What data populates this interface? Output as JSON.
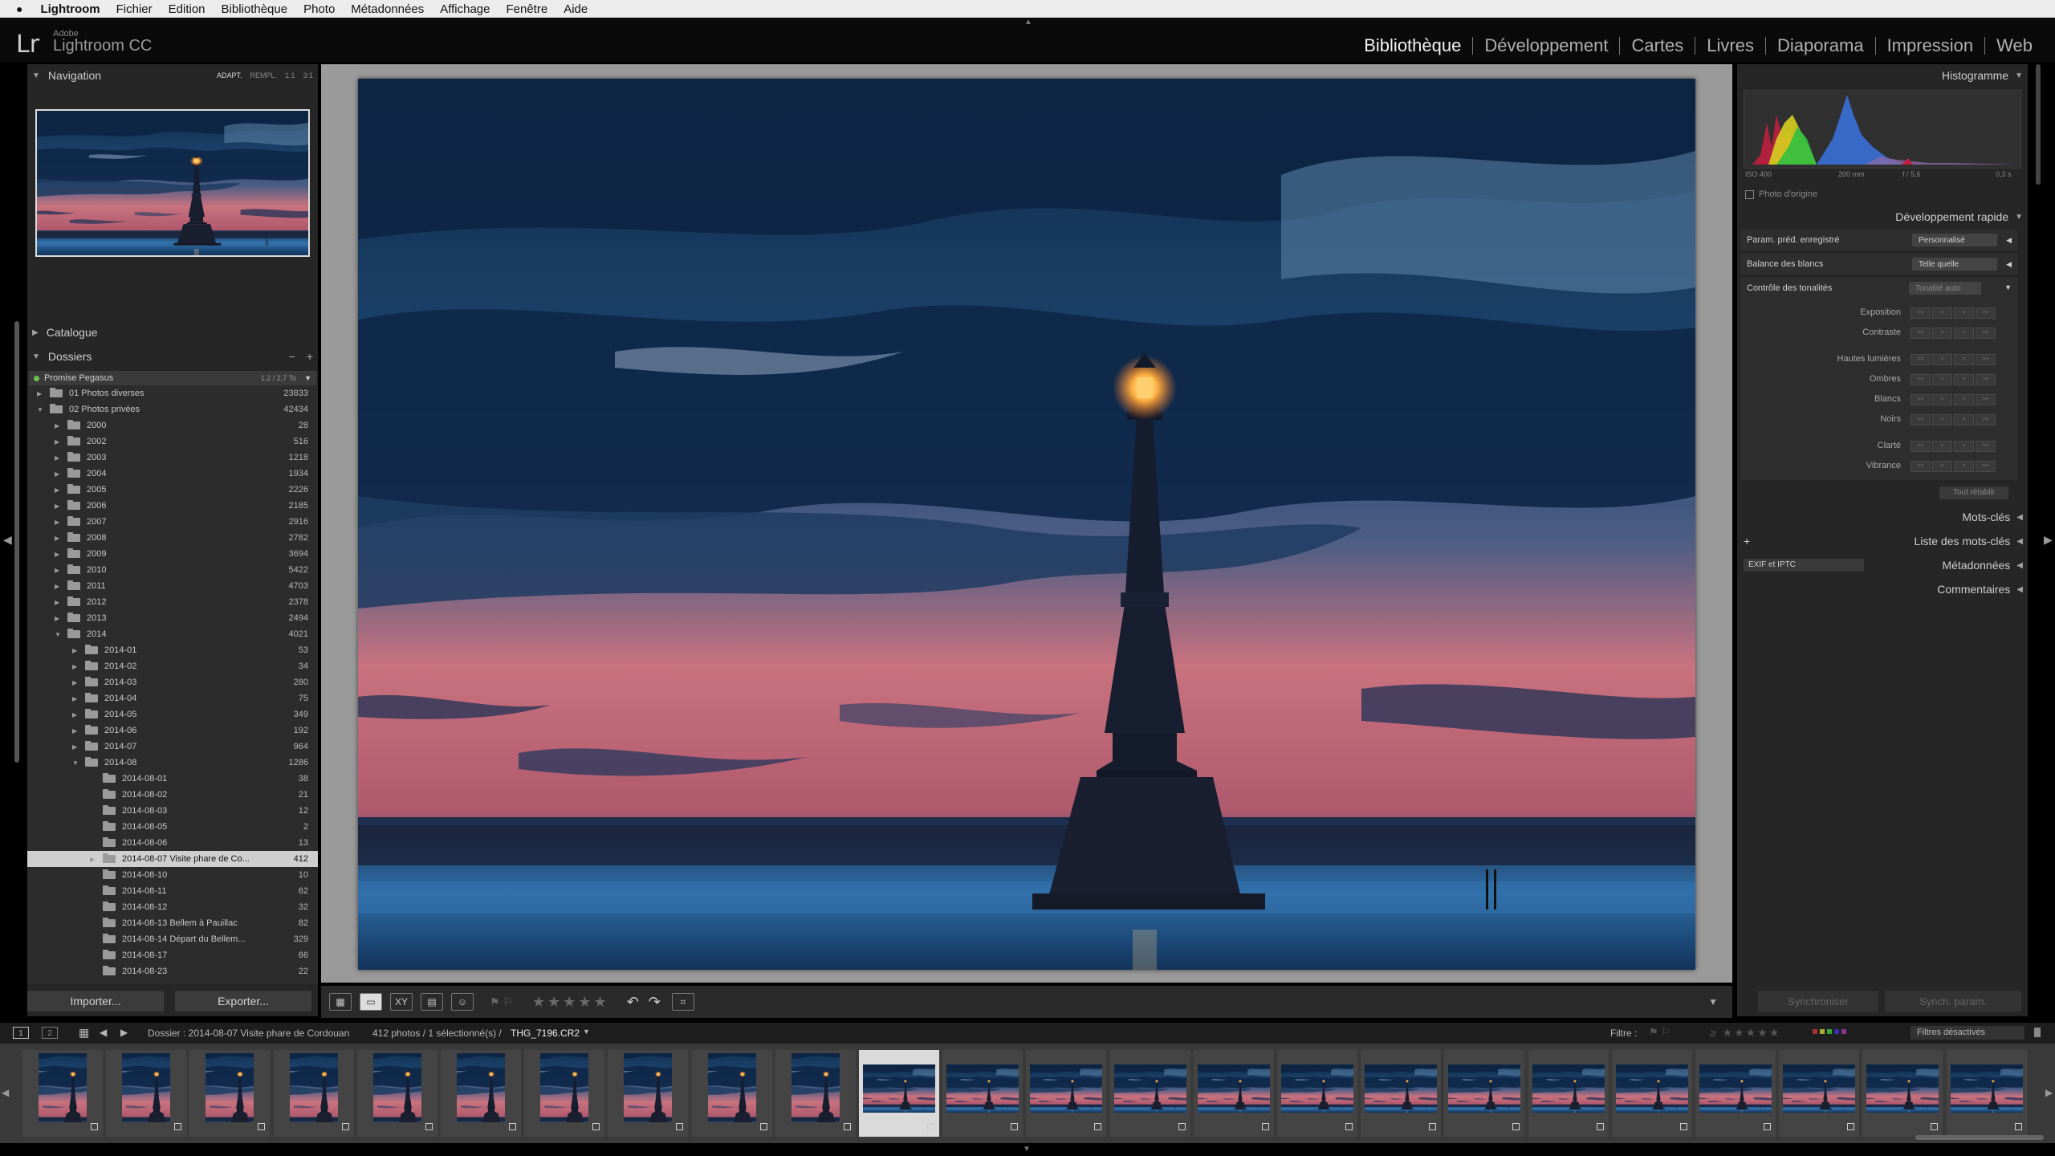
{
  "menu": {
    "apple": "",
    "app": "Lightroom",
    "items": [
      "Fichier",
      "Edition",
      "Bibliothèque",
      "Photo",
      "Métadonnées",
      "Affichage",
      "Fenêtre",
      "Aide"
    ]
  },
  "identity": {
    "logo": "Lr",
    "adobe": "Adobe",
    "name": "Lightroom CC"
  },
  "modules": [
    "Bibliothèque",
    "Développement",
    "Cartes",
    "Livres",
    "Diaporama",
    "Impression",
    "Web"
  ],
  "left": {
    "navigation": {
      "title": "Navigation",
      "options": [
        "ADAPT.",
        "REMPL.",
        "1:1",
        "3:1"
      ]
    },
    "catalogue": "Catalogue",
    "dossiers": "Dossiers",
    "volume": {
      "name": "Promise Pegasus",
      "size": "1,2 / 2,7 To"
    },
    "folders": [
      {
        "name": "01 Photos diverses",
        "count": "23833",
        "level": 0,
        "tri": "▶"
      },
      {
        "name": "02 Photos privées",
        "count": "42434",
        "level": 0,
        "tri": "▼"
      },
      {
        "name": "2000",
        "count": "28",
        "level": 1,
        "tri": "▶"
      },
      {
        "name": "2002",
        "count": "516",
        "level": 1,
        "tri": "▶"
      },
      {
        "name": "2003",
        "count": "1218",
        "level": 1,
        "tri": "▶"
      },
      {
        "name": "2004",
        "count": "1934",
        "level": 1,
        "tri": "▶"
      },
      {
        "name": "2005",
        "count": "2226",
        "level": 1,
        "tri": "▶"
      },
      {
        "name": "2006",
        "count": "2185",
        "level": 1,
        "tri": "▶"
      },
      {
        "name": "2007",
        "count": "2916",
        "level": 1,
        "tri": "▶"
      },
      {
        "name": "2008",
        "count": "2782",
        "level": 1,
        "tri": "▶"
      },
      {
        "name": "2009",
        "count": "3694",
        "level": 1,
        "tri": "▶"
      },
      {
        "name": "2010",
        "count": "5422",
        "level": 1,
        "tri": "▶"
      },
      {
        "name": "2011",
        "count": "4703",
        "level": 1,
        "tri": "▶"
      },
      {
        "name": "2012",
        "count": "2378",
        "level": 1,
        "tri": "▶"
      },
      {
        "name": "2013",
        "count": "2494",
        "level": 1,
        "tri": "▶"
      },
      {
        "name": "2014",
        "count": "4021",
        "level": 1,
        "tri": "▼"
      },
      {
        "name": "2014-01",
        "count": "53",
        "level": 2,
        "tri": "▶"
      },
      {
        "name": "2014-02",
        "count": "34",
        "level": 2,
        "tri": "▶"
      },
      {
        "name": "2014-03",
        "count": "280",
        "level": 2,
        "tri": "▶"
      },
      {
        "name": "2014-04",
        "count": "75",
        "level": 2,
        "tri": "▶"
      },
      {
        "name": "2014-05",
        "count": "349",
        "level": 2,
        "tri": "▶"
      },
      {
        "name": "2014-06",
        "count": "192",
        "level": 2,
        "tri": "▶"
      },
      {
        "name": "2014-07",
        "count": "964",
        "level": 2,
        "tri": "▶"
      },
      {
        "name": "2014-08",
        "count": "1286",
        "level": 2,
        "tri": "▼"
      },
      {
        "name": "2014-08-01",
        "count": "38",
        "level": 3,
        "tri": ""
      },
      {
        "name": "2014-08-02",
        "count": "21",
        "level": 3,
        "tri": ""
      },
      {
        "name": "2014-08-03",
        "count": "12",
        "level": 3,
        "tri": ""
      },
      {
        "name": "2014-08-05",
        "count": "2",
        "level": 3,
        "tri": ""
      },
      {
        "name": "2014-08-06",
        "count": "13",
        "level": 3,
        "tri": ""
      },
      {
        "name": "2014-08-07 Visite phare de Co...",
        "count": "412",
        "level": 3,
        "tri": "▶",
        "selected": true
      },
      {
        "name": "2014-08-10",
        "count": "10",
        "level": 3,
        "tri": ""
      },
      {
        "name": "2014-08-11",
        "count": "62",
        "level": 3,
        "tri": ""
      },
      {
        "name": "2014-08-12",
        "count": "32",
        "level": 3,
        "tri": ""
      },
      {
        "name": "2014-08-13 Bellem à Pauillac",
        "count": "82",
        "level": 3,
        "tri": ""
      },
      {
        "name": "2014-08-14 Départ du Bellem...",
        "count": "329",
        "level": 3,
        "tri": ""
      },
      {
        "name": "2014-08-17",
        "count": "66",
        "level": 3,
        "tri": ""
      },
      {
        "name": "2014-08-23",
        "count": "22",
        "level": 3,
        "tri": ""
      }
    ],
    "import_label": "Importer...",
    "export_label": "Exporter..."
  },
  "right": {
    "histogramme": "Histogramme",
    "iso": "ISO 400",
    "focal": "200 mm",
    "aperture": "f / 5,6",
    "shutter": "0,3 s",
    "original": "Photo d'origine",
    "dev_rapide": "Développement rapide",
    "preset_label": "Param. préd. enregistré",
    "preset_value": "Personnalisé",
    "wb_label": "Balance des blancs",
    "wb_value": "Telle quelle",
    "tone_label": "Contrôle des tonalités",
    "tone_auto": "Tonalité auto",
    "sliders": [
      "Exposition",
      "Contraste",
      "Hautes lumières",
      "Ombres",
      "Blancs",
      "Noirs",
      "Clarté",
      "Vibrance"
    ],
    "reset": "Tout rétablir",
    "keywords": "Mots-clés",
    "keyword_list": "Liste des mots-clés",
    "metadata": "Métadonnées",
    "metadata_preset": "EXIF et IPTC",
    "comments": "Commentaires",
    "sync": "Synchroniser",
    "sync_settings": "Synch. param."
  },
  "filmbar": {
    "screen1": "1",
    "screen2": "2",
    "folder": "Dossier : 2014-08-07 Visite phare de Cordouan",
    "count": "412 photos / 1 sélectionné(s) /",
    "file": "THG_7196.CR2",
    "filter_label": "Filtre :",
    "filter_value": "Filtres désactivés"
  },
  "colors": {
    "accent": "#cfcfcf",
    "panel": "#262626",
    "center": "#9a9a9a"
  }
}
